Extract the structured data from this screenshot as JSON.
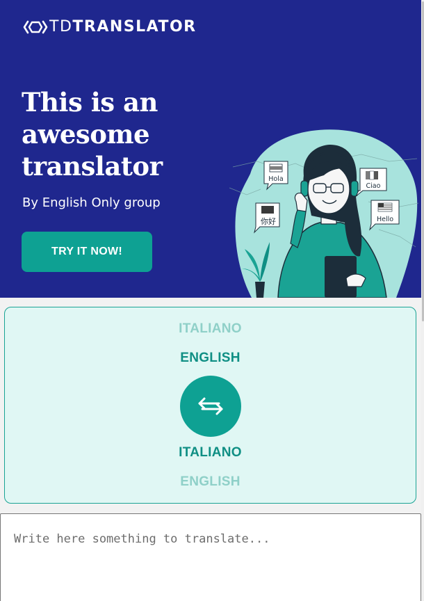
{
  "header": {
    "logo_bold_prefix": "TD",
    "logo_name": "TRANSLATOR"
  },
  "hero": {
    "title": "This is an awesome translator",
    "subtitle": "By English Only group",
    "cta_label": "TRY IT NOW!",
    "bubbles": {
      "spanish": "Hola",
      "italian": "Ciao",
      "chinese": "你好",
      "english": "Hello"
    }
  },
  "languages": {
    "source_options": [
      "ITALIANO",
      "ENGLISH"
    ],
    "source_selected": "ENGLISH",
    "target_options": [
      "ITALIANO",
      "ENGLISH"
    ],
    "target_selected": "ITALIANO"
  },
  "input": {
    "placeholder": "Write here something to translate..."
  },
  "colors": {
    "hero_bg": "#1f278e",
    "accent": "#0ea193",
    "panel_bg": "#e0f7f4"
  }
}
